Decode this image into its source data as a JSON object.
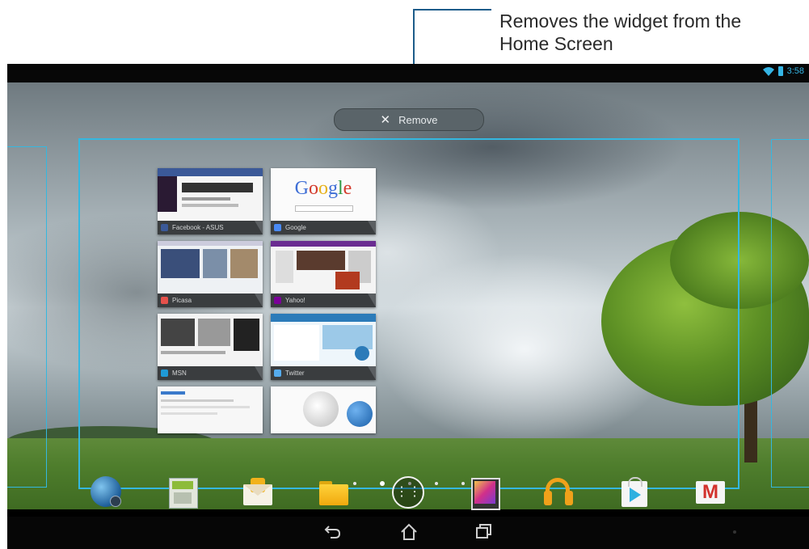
{
  "annotation": {
    "line1": "Removes the widget from the",
    "line2": "Home Screen",
    "line_color": "#1d5c8a"
  },
  "status_bar": {
    "time": "3:58",
    "icons": [
      "wifi-icon",
      "battery-icon"
    ],
    "accent": "#35b5e5"
  },
  "remove_bar": {
    "icon": "close-icon",
    "label": "Remove"
  },
  "frame_color": "#34b8e0",
  "bookmarks_widget": {
    "items": [
      {
        "label": "Facebook - ASUS",
        "icon": "facebook-icon"
      },
      {
        "label": "Google",
        "icon": "google-icon"
      },
      {
        "label": "Picasa",
        "icon": "picasa-icon"
      },
      {
        "label": "Yahoo!",
        "icon": "yahoo-icon"
      },
      {
        "label": "MSN",
        "icon": "msn-icon"
      },
      {
        "label": "Twitter",
        "icon": "twitter-icon"
      },
      {
        "label": "",
        "icon": ""
      },
      {
        "label": "",
        "icon": "wikipedia-globe-icon"
      }
    ],
    "google_logo": "Google"
  },
  "page_indicator": {
    "count": 5,
    "active": 2
  },
  "dock": [
    {
      "name": "browser-icon"
    },
    {
      "name": "file-manager-icon"
    },
    {
      "name": "email-icon"
    },
    {
      "name": "folder-icon"
    },
    {
      "name": "all-apps-icon"
    },
    {
      "name": "gallery-icon"
    },
    {
      "name": "music-headphones-icon"
    },
    {
      "name": "play-store-icon"
    },
    {
      "name": "gmail-icon"
    }
  ],
  "nav_bar": [
    "back-icon",
    "home-icon",
    "recent-apps-icon"
  ]
}
